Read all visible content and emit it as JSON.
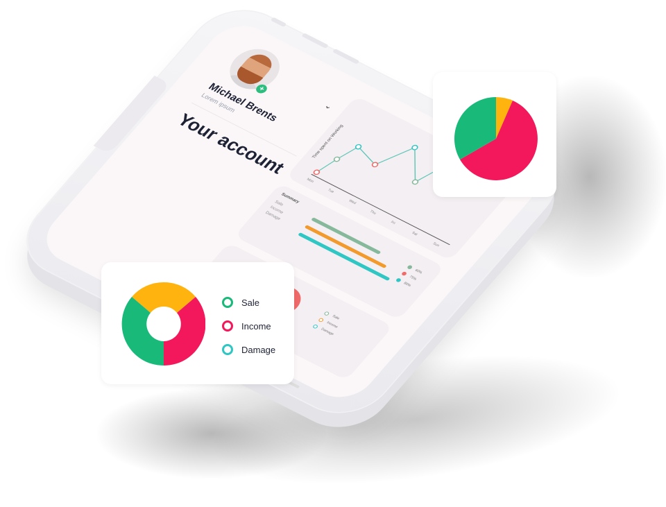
{
  "profile": {
    "name": "Michael Brents",
    "subtitle": "Lorem ipsum",
    "add_badge": "+",
    "chevron": "⌄"
  },
  "page": {
    "title": "Your account"
  },
  "line_chart": {
    "label": "Time spent on Working",
    "days": [
      "Mon",
      "Tue",
      "Wed",
      "Thu",
      "Fri",
      "Sat",
      "Sun"
    ]
  },
  "summary": {
    "title": "Summary",
    "items": [
      "Sale",
      "Income",
      "Damage"
    ],
    "percents": [
      "60%",
      "75%",
      "80%"
    ]
  },
  "small_legend": [
    "Sale",
    "Income",
    "Damage"
  ],
  "float_card_legend": [
    {
      "label": "Sale",
      "color": "#19b97a"
    },
    {
      "label": "Income",
      "color": "#f3175b"
    },
    {
      "label": "Damage",
      "color": "#2fc6c4"
    }
  ],
  "colors": {
    "green": "#19b97a",
    "pink": "#f3175b",
    "yellow": "#ffb30f",
    "teal": "#2fc6c4",
    "sage": "#86b99b",
    "coral": "#f06a6a",
    "orange": "#f39a2d",
    "text_dark": "#1e2235"
  }
}
